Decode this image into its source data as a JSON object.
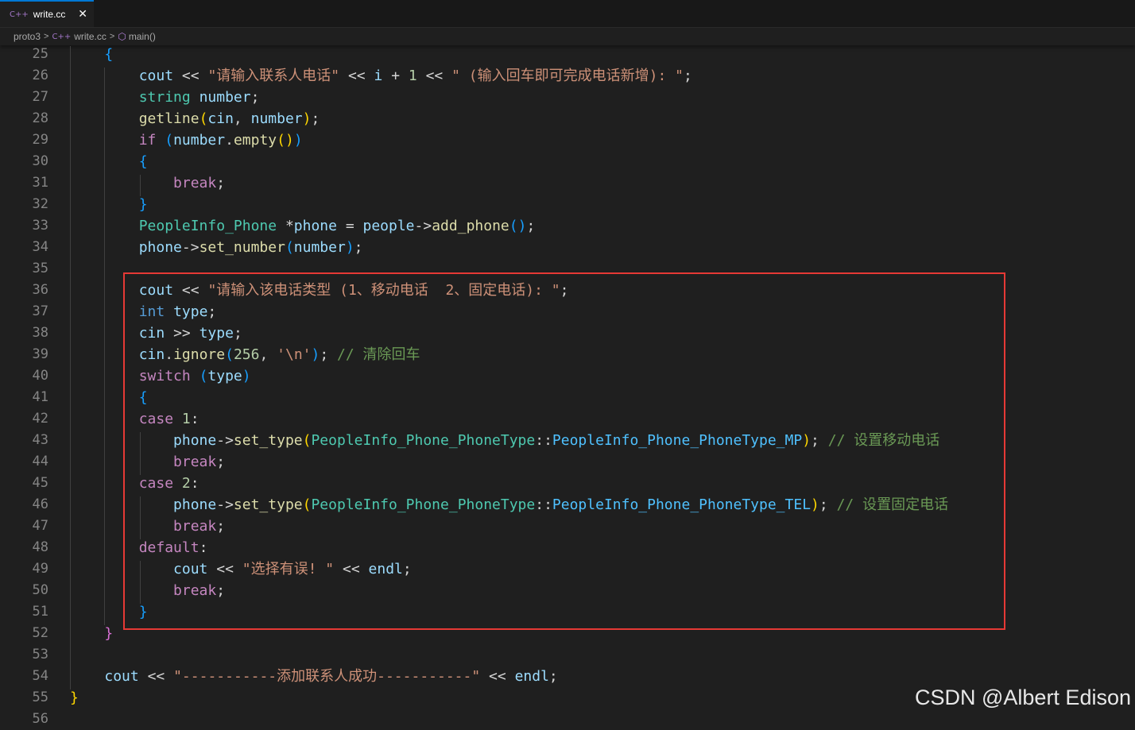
{
  "tab": {
    "label": "write.cc",
    "icon": "cpp-file-icon",
    "close": "✕",
    "icon_glyph": "C++"
  },
  "breadcrumb": {
    "folder": "proto3",
    "file": "write.cc",
    "symbol": "main()"
  },
  "colors": {
    "keyword": "#569cd6",
    "control": "#c586c0",
    "type": "#4ec9b0",
    "function": "#dcdcaa",
    "variable": "#9cdcfe",
    "string": "#ce9178",
    "number": "#b5cea8",
    "comment": "#6a9955",
    "highlight_box": "#e53935"
  },
  "editor": {
    "lines": [
      {
        "n": "25",
        "html": "    <span class=\"b3\">{</span>"
      },
      {
        "n": "26",
        "html": "        <span class=\"vr\">cout</span> <span class=\"op\">&lt;&lt;</span> <span class=\"st\">\"请输入联系人电话\"</span> <span class=\"op\">&lt;&lt;</span> <span class=\"vr\">i</span> <span class=\"op\">+</span> <span class=\"nm\">1</span> <span class=\"op\">&lt;&lt;</span> <span class=\"st\">\" (输入回车即可完成电话新增): \"</span><span class=\"op\">;</span>"
      },
      {
        "n": "27",
        "html": "        <span class=\"ty\">string</span> <span class=\"vr\">number</span><span class=\"op\">;</span>"
      },
      {
        "n": "28",
        "html": "        <span class=\"fn\">getline</span><span class=\"b1\">(</span><span class=\"vr\">cin</span>, <span class=\"vr\">number</span><span class=\"b1\">)</span><span class=\"op\">;</span>"
      },
      {
        "n": "29",
        "html": "        <span class=\"ct\">if</span> <span class=\"b3\">(</span><span class=\"vr\">number</span>.<span class=\"fn\">empty</span><span class=\"b1\">()</span><span class=\"b3\">)</span>"
      },
      {
        "n": "30",
        "html": "        <span class=\"b3\">{</span>"
      },
      {
        "n": "31",
        "html": "            <span class=\"ct\">break</span><span class=\"op\">;</span>"
      },
      {
        "n": "32",
        "html": "        <span class=\"b3\">}</span>"
      },
      {
        "n": "33",
        "html": "        <span class=\"ty\">PeopleInfo_Phone</span> <span class=\"op\">*</span><span class=\"vr\">phone</span> <span class=\"op\">=</span> <span class=\"vr\">people</span><span class=\"op\">-&gt;</span><span class=\"fn\">add_phone</span><span class=\"b3\">()</span><span class=\"op\">;</span>"
      },
      {
        "n": "34",
        "html": "        <span class=\"vr\">phone</span><span class=\"op\">-&gt;</span><span class=\"fn\">set_number</span><span class=\"b3\">(</span><span class=\"vr\">number</span><span class=\"b3\">)</span><span class=\"op\">;</span>"
      },
      {
        "n": "35",
        "html": ""
      },
      {
        "n": "36",
        "html": "        <span class=\"vr\">cout</span> <span class=\"op\">&lt;&lt;</span> <span class=\"st\">\"请输入该电话类型 (1、移动电话  2、固定电话): \"</span><span class=\"op\">;</span>"
      },
      {
        "n": "37",
        "html": "        <span class=\"kw\">int</span> <span class=\"vr\">type</span><span class=\"op\">;</span>"
      },
      {
        "n": "38",
        "html": "        <span class=\"vr\">cin</span> <span class=\"op\">&gt;&gt;</span> <span class=\"vr\">type</span><span class=\"op\">;</span>"
      },
      {
        "n": "39",
        "html": "        <span class=\"vr\">cin</span>.<span class=\"fn\">ignore</span><span class=\"b3\">(</span><span class=\"nm\">256</span>, <span class=\"st\">'\\n'</span><span class=\"b3\">)</span><span class=\"op\">;</span> <span class=\"cm\">// 清除回车</span>"
      },
      {
        "n": "40",
        "html": "        <span class=\"ct\">switch</span> <span class=\"b3\">(</span><span class=\"vr\">type</span><span class=\"b3\">)</span>"
      },
      {
        "n": "41",
        "html": "        <span class=\"b3\">{</span>"
      },
      {
        "n": "42",
        "html": "        <span class=\"ct\">case</span> <span class=\"nm\">1</span><span class=\"op\">:</span>"
      },
      {
        "n": "43",
        "html": "            <span class=\"vr\">phone</span><span class=\"op\">-&gt;</span><span class=\"fn\">set_type</span><span class=\"b1\">(</span><span class=\"ty\">PeopleInfo_Phone_PhoneType</span><span class=\"op\">::</span><span class=\"en\">PeopleInfo_Phone_PhoneType_MP</span><span class=\"b1\">)</span><span class=\"op\">;</span> <span class=\"cm\">// 设置移动电话</span>"
      },
      {
        "n": "44",
        "html": "            <span class=\"ct\">break</span><span class=\"op\">;</span>"
      },
      {
        "n": "45",
        "html": "        <span class=\"ct\">case</span> <span class=\"nm\">2</span><span class=\"op\">:</span>"
      },
      {
        "n": "46",
        "html": "            <span class=\"vr\">phone</span><span class=\"op\">-&gt;</span><span class=\"fn\">set_type</span><span class=\"b1\">(</span><span class=\"ty\">PeopleInfo_Phone_PhoneType</span><span class=\"op\">::</span><span class=\"en\">PeopleInfo_Phone_PhoneType_TEL</span><span class=\"b1\">)</span><span class=\"op\">;</span> <span class=\"cm\">// 设置固定电话</span>"
      },
      {
        "n": "47",
        "html": "            <span class=\"ct\">break</span><span class=\"op\">;</span>"
      },
      {
        "n": "48",
        "html": "        <span class=\"ct\">default</span><span class=\"op\">:</span>"
      },
      {
        "n": "49",
        "html": "            <span class=\"vr\">cout</span> <span class=\"op\">&lt;&lt;</span> <span class=\"st\">\"选择有误! \"</span> <span class=\"op\">&lt;&lt;</span> <span class=\"vr\">endl</span><span class=\"op\">;</span>"
      },
      {
        "n": "50",
        "html": "            <span class=\"ct\">break</span><span class=\"op\">;</span>"
      },
      {
        "n": "51",
        "html": "        <span class=\"b3\">}</span>"
      },
      {
        "n": "52",
        "html": "    <span class=\"b2\">}</span>"
      },
      {
        "n": "53",
        "html": ""
      },
      {
        "n": "54",
        "html": "    <span class=\"vr\">cout</span> <span class=\"op\">&lt;&lt;</span> <span class=\"st\">\"-----------添加联系人成功-----------\"</span> <span class=\"op\">&lt;&lt;</span> <span class=\"vr\">endl</span><span class=\"op\">;</span>"
      },
      {
        "n": "55",
        "html": "<span class=\"b1\">}</span>"
      },
      {
        "n": "56",
        "html": ""
      }
    ]
  },
  "watermark": "CSDN @Albert Edison"
}
